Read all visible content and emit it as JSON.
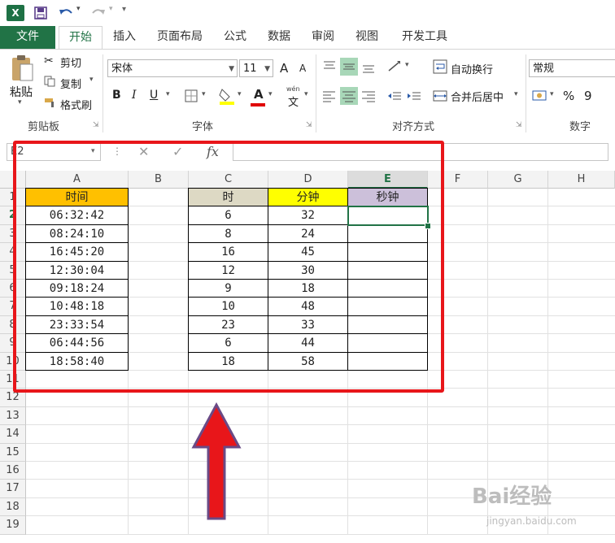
{
  "qat": {
    "excel_logo": "X",
    "save_icon": "save-icon",
    "undo_icon": "undo-icon",
    "redo_icon": "redo-icon"
  },
  "tabs": [
    "文件",
    "开始",
    "插入",
    "页面布局",
    "公式",
    "数据",
    "审阅",
    "视图",
    "开发工具"
  ],
  "ribbon": {
    "clipboard": {
      "paste": "粘贴",
      "cut": "剪切",
      "copy": "复制",
      "format_painter": "格式刷",
      "group": "剪贴板"
    },
    "font": {
      "font_name": "宋体",
      "font_size": "11",
      "grow": "A",
      "shrink": "A",
      "bold": "B",
      "italic": "I",
      "underline": "U",
      "font_color_letter": "A",
      "wen": "wén",
      "wen_char": "文",
      "group": "字体"
    },
    "alignment": {
      "wrap_text": "自动换行",
      "merge_center": "合并后居中",
      "group": "对齐方式"
    },
    "number": {
      "format": "常规",
      "percent": "%",
      "comma": "9",
      "group": "数字"
    }
  },
  "formula_bar": {
    "name_box": "E2",
    "cancel": "✕",
    "enter": "✓",
    "fx": "fx",
    "content": ""
  },
  "columns": [
    "A",
    "B",
    "C",
    "D",
    "E",
    "F",
    "G",
    "H"
  ],
  "rows": [
    "1",
    "2",
    "3",
    "4",
    "5",
    "6",
    "7",
    "8",
    "9",
    "10",
    "11",
    "12",
    "13",
    "14",
    "15",
    "16",
    "17",
    "18",
    "19"
  ],
  "table1": {
    "header": "时间",
    "header_color": "#ffc000",
    "values": [
      "06:32:42",
      "08:24:10",
      "16:45:20",
      "12:30:04",
      "09:18:24",
      "10:48:18",
      "23:33:54",
      "06:44:56",
      "18:58:40"
    ]
  },
  "table2": {
    "headers": [
      "时",
      "分钟",
      "秒钟"
    ],
    "header_colors": [
      "#ddd9c4",
      "#ffff00",
      "#ccc0da"
    ],
    "hours": [
      "6",
      "8",
      "16",
      "12",
      "9",
      "10",
      "23",
      "6",
      "18"
    ],
    "minutes": [
      "32",
      "24",
      "45",
      "30",
      "18",
      "48",
      "33",
      "44",
      "58"
    ]
  },
  "selected_cell": "E2",
  "annotation": {
    "highlight_color": "#e8161a"
  },
  "watermark": {
    "text": "Bai经验",
    "url": "jingyan.baidu.com"
  }
}
